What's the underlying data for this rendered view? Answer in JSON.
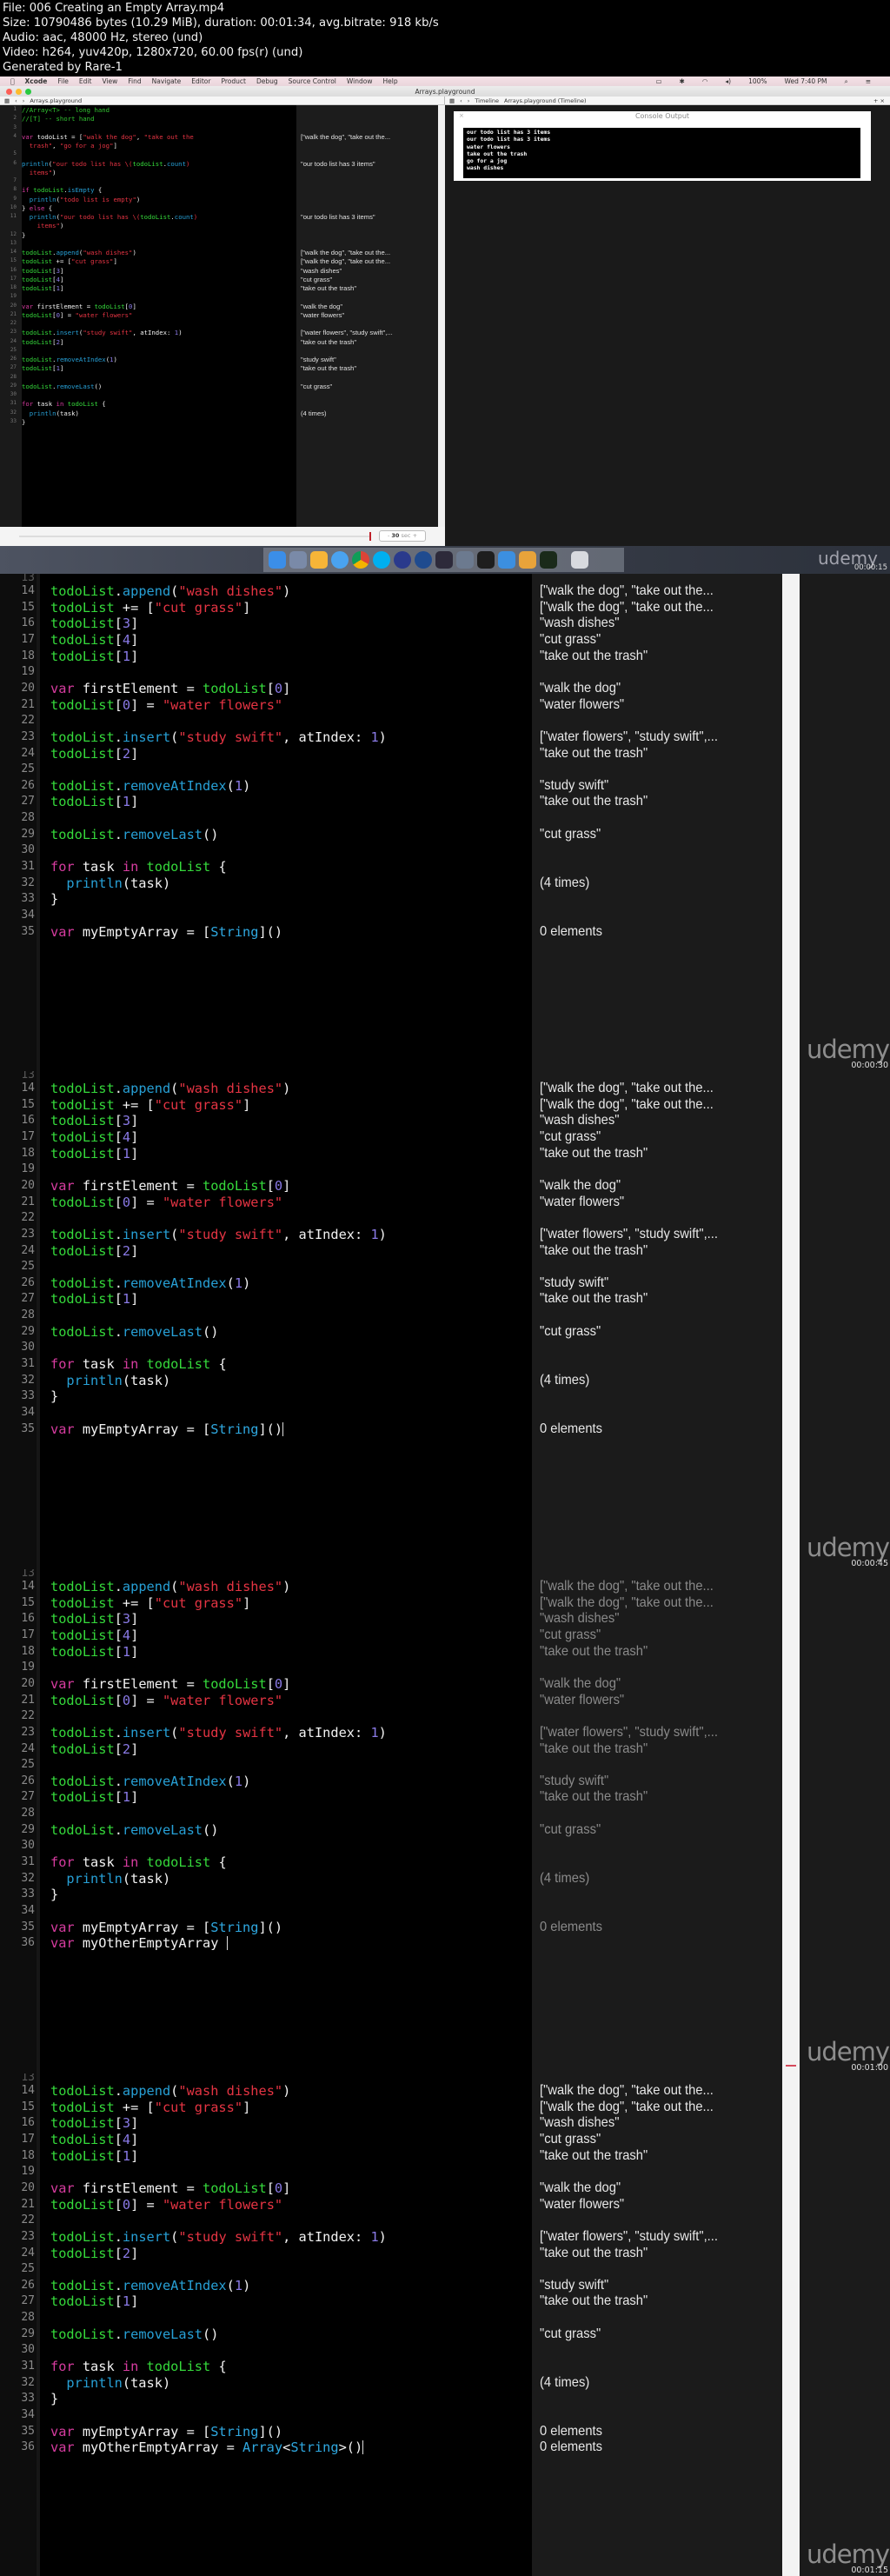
{
  "file_info": {
    "file": "File: 006 Creating an Empty Array.mp4",
    "size": "Size: 10790486 bytes (10.29 MiB), duration: 00:01:34, avg.bitrate: 918 kb/s",
    "audio": "Audio: aac, 48000 Hz, stereo (und)",
    "video": "Video: h264, yuv420p, 1280x720, 60.00 fps(r) (und)",
    "generator": "Generated by Rare-1"
  },
  "menubar": {
    "apple": "",
    "app": "Xcode",
    "items": [
      "File",
      "Edit",
      "View",
      "Find",
      "Navigate",
      "Editor",
      "Product",
      "Debug",
      "Source Control",
      "Window",
      "Help"
    ],
    "battery": "100%",
    "clock": "Wed 7:40 PM"
  },
  "window": {
    "title": "Arrays.playground",
    "left_jump": "Arrays.playground",
    "right_jump_1": "Timeline",
    "right_jump_2": "Arrays.playground (Timeline)",
    "add": "+",
    "close": "×"
  },
  "code_full": [
    {
      "n": "1",
      "t": [
        [
          "cm",
          "//Array<T> -- long hand"
        ]
      ]
    },
    {
      "n": "2",
      "t": [
        [
          "cm",
          "//[T] -- short hand"
        ]
      ]
    },
    {
      "n": "3",
      "t": []
    },
    {
      "n": "4",
      "t": [
        [
          "kw",
          "var"
        ],
        [
          "pl",
          " todoList = ["
        ],
        [
          "st",
          "\"walk the dog\""
        ],
        [
          "pl",
          ", "
        ],
        [
          "st",
          "\"take out the"
        ]
      ]
    },
    {
      "n": "",
      "t": [
        [
          "st",
          "  trash\""
        ],
        [
          "pl",
          ", "
        ],
        [
          "st",
          "\"go for a jog\""
        ],
        [
          "pl",
          "]"
        ]
      ]
    },
    {
      "n": "5",
      "t": []
    },
    {
      "n": "6",
      "t": [
        [
          "fn",
          "println"
        ],
        [
          "pl",
          "("
        ],
        [
          "st",
          "\"our todo list has \\("
        ],
        [
          "id",
          "todoList"
        ],
        [
          "pl",
          "."
        ],
        [
          "fn",
          "count"
        ],
        [
          "st",
          ")"
        ]
      ]
    },
    {
      "n": "",
      "t": [
        [
          "st",
          "  items\""
        ],
        [
          "pl",
          ")"
        ]
      ]
    },
    {
      "n": "7",
      "t": []
    },
    {
      "n": "8",
      "t": [
        [
          "kw",
          "if"
        ],
        [
          "pl",
          " "
        ],
        [
          "id",
          "todoList"
        ],
        [
          "pl",
          "."
        ],
        [
          "fn",
          "isEmpty"
        ],
        [
          "pl",
          " {"
        ]
      ]
    },
    {
      "n": "9",
      "t": [
        [
          "pl",
          "  "
        ],
        [
          "fn",
          "println"
        ],
        [
          "pl",
          "("
        ],
        [
          "st",
          "\"todo list is empty\""
        ],
        [
          "pl",
          ")"
        ]
      ]
    },
    {
      "n": "10",
      "t": [
        [
          "pl",
          "} "
        ],
        [
          "kw",
          "else"
        ],
        [
          "pl",
          " {"
        ]
      ]
    },
    {
      "n": "11",
      "t": [
        [
          "pl",
          "  "
        ],
        [
          "fn",
          "println"
        ],
        [
          "pl",
          "("
        ],
        [
          "st",
          "\"our todo list has \\("
        ],
        [
          "id",
          "todoList"
        ],
        [
          "pl",
          "."
        ],
        [
          "fn",
          "count"
        ],
        [
          "st",
          ")"
        ]
      ]
    },
    {
      "n": "",
      "t": [
        [
          "st",
          "    items\""
        ],
        [
          "pl",
          ")"
        ]
      ]
    },
    {
      "n": "12",
      "t": [
        [
          "pl",
          "}"
        ]
      ]
    },
    {
      "n": "13",
      "t": []
    },
    {
      "n": "14",
      "t": [
        [
          "id",
          "todoList"
        ],
        [
          "pl",
          "."
        ],
        [
          "fn",
          "append"
        ],
        [
          "pl",
          "("
        ],
        [
          "st",
          "\"wash dishes\""
        ],
        [
          "pl",
          ")"
        ]
      ]
    },
    {
      "n": "15",
      "t": [
        [
          "id",
          "todoList"
        ],
        [
          "pl",
          " += ["
        ],
        [
          "st",
          "\"cut grass\""
        ],
        [
          "pl",
          "]"
        ]
      ]
    },
    {
      "n": "16",
      "t": [
        [
          "id",
          "todoList"
        ],
        [
          "pl",
          "["
        ],
        [
          "nm",
          "3"
        ],
        [
          "pl",
          "]"
        ]
      ]
    },
    {
      "n": "17",
      "t": [
        [
          "id",
          "todoList"
        ],
        [
          "pl",
          "["
        ],
        [
          "nm",
          "4"
        ],
        [
          "pl",
          "]"
        ]
      ]
    },
    {
      "n": "18",
      "t": [
        [
          "id",
          "todoList"
        ],
        [
          "pl",
          "["
        ],
        [
          "nm",
          "1"
        ],
        [
          "pl",
          "]"
        ]
      ]
    },
    {
      "n": "19",
      "t": []
    },
    {
      "n": "20",
      "t": [
        [
          "kw",
          "var"
        ],
        [
          "pl",
          " firstElement = "
        ],
        [
          "id",
          "todoList"
        ],
        [
          "pl",
          "["
        ],
        [
          "nm",
          "0"
        ],
        [
          "pl",
          "]"
        ]
      ]
    },
    {
      "n": "21",
      "t": [
        [
          "id",
          "todoList"
        ],
        [
          "pl",
          "["
        ],
        [
          "nm",
          "0"
        ],
        [
          "pl",
          "] = "
        ],
        [
          "st",
          "\"water flowers\""
        ]
      ]
    },
    {
      "n": "22",
      "t": []
    },
    {
      "n": "23",
      "t": [
        [
          "id",
          "todoList"
        ],
        [
          "pl",
          "."
        ],
        [
          "fn",
          "insert"
        ],
        [
          "pl",
          "("
        ],
        [
          "st",
          "\"study swift\""
        ],
        [
          "pl",
          ", atIndex: "
        ],
        [
          "nm",
          "1"
        ],
        [
          "pl",
          ")"
        ]
      ]
    },
    {
      "n": "24",
      "t": [
        [
          "id",
          "todoList"
        ],
        [
          "pl",
          "["
        ],
        [
          "nm",
          "2"
        ],
        [
          "pl",
          "]"
        ]
      ]
    },
    {
      "n": "25",
      "t": []
    },
    {
      "n": "26",
      "t": [
        [
          "id",
          "todoList"
        ],
        [
          "pl",
          "."
        ],
        [
          "fn",
          "removeAtIndex"
        ],
        [
          "pl",
          "("
        ],
        [
          "nm",
          "1"
        ],
        [
          "pl",
          ")"
        ]
      ]
    },
    {
      "n": "27",
      "t": [
        [
          "id",
          "todoList"
        ],
        [
          "pl",
          "["
        ],
        [
          "nm",
          "1"
        ],
        [
          "pl",
          "]"
        ]
      ]
    },
    {
      "n": "28",
      "t": []
    },
    {
      "n": "29",
      "t": [
        [
          "id",
          "todoList"
        ],
        [
          "pl",
          "."
        ],
        [
          "fn",
          "removeLast"
        ],
        [
          "pl",
          "()"
        ]
      ]
    },
    {
      "n": "30",
      "t": []
    },
    {
      "n": "31",
      "t": [
        [
          "kw",
          "for"
        ],
        [
          "pl",
          " task "
        ],
        [
          "kw",
          "in"
        ],
        [
          "pl",
          " "
        ],
        [
          "id",
          "todoList"
        ],
        [
          "pl",
          " {"
        ]
      ]
    },
    {
      "n": "32",
      "t": [
        [
          "pl",
          "  "
        ],
        [
          "fn",
          "println"
        ],
        [
          "pl",
          "(task)"
        ]
      ]
    },
    {
      "n": "33",
      "t": [
        [
          "pl",
          "}"
        ]
      ]
    }
  ],
  "results_full": [
    "",
    "",
    "",
    "[\"walk the dog\", \"take out the...",
    "",
    "",
    "\"our todo list has 3 items\"",
    "",
    "",
    "",
    "",
    "",
    "\"our todo list has 3 items\"",
    "",
    "",
    "",
    "[\"walk the dog\", \"take out the...",
    "[\"walk the dog\", \"take out the...",
    "\"wash dishes\"",
    "\"cut grass\"",
    "\"take out the trash\"",
    "",
    "\"walk the dog\"",
    "\"water flowers\"",
    "",
    "[\"water flowers\", \"study swift\",...",
    "\"take out the trash\"",
    "",
    "\"study swift\"",
    "\"take out the trash\"",
    "",
    "\"cut grass\"",
    "",
    "",
    "(4 times)",
    ""
  ],
  "console": {
    "title": "Console Output",
    "close": "×",
    "lines": [
      "our todo list has 3 items",
      "our todo list has 3 items",
      "water flowers",
      "take out the trash",
      "go for a jog",
      "wash dishes"
    ]
  },
  "timeline": {
    "duration_value": "30",
    "duration_unit": "sec",
    "minus": "-",
    "plus": "+"
  },
  "watermark": "udemy",
  "timestamps": [
    "00:00:15",
    "00:00:30",
    "00:00:45",
    "00:01:00",
    "00:01:15"
  ],
  "zoom_code": [
    {
      "n": "14",
      "t": [
        [
          "id",
          "todoList"
        ],
        [
          "pl",
          "."
        ],
        [
          "fn",
          "append"
        ],
        [
          "pl",
          "("
        ],
        [
          "st",
          "\"wash dishes\""
        ],
        [
          "pl",
          ")"
        ]
      ],
      "r": "[\"walk the dog\", \"take out the..."
    },
    {
      "n": "15",
      "t": [
        [
          "id",
          "todoList"
        ],
        [
          "pl",
          " += ["
        ],
        [
          "st",
          "\"cut grass\""
        ],
        [
          "pl",
          "]"
        ]
      ],
      "r": "[\"walk the dog\", \"take out the..."
    },
    {
      "n": "16",
      "t": [
        [
          "id",
          "todoList"
        ],
        [
          "pl",
          "["
        ],
        [
          "nm",
          "3"
        ],
        [
          "pl",
          "]"
        ]
      ],
      "r": "\"wash dishes\""
    },
    {
      "n": "17",
      "t": [
        [
          "id",
          "todoList"
        ],
        [
          "pl",
          "["
        ],
        [
          "nm",
          "4"
        ],
        [
          "pl",
          "]"
        ]
      ],
      "r": "\"cut grass\""
    },
    {
      "n": "18",
      "t": [
        [
          "id",
          "todoList"
        ],
        [
          "pl",
          "["
        ],
        [
          "nm",
          "1"
        ],
        [
          "pl",
          "]"
        ]
      ],
      "r": "\"take out the trash\""
    },
    {
      "n": "19",
      "t": [],
      "r": ""
    },
    {
      "n": "20",
      "t": [
        [
          "kw",
          "var"
        ],
        [
          "pl",
          " firstElement = "
        ],
        [
          "id",
          "todoList"
        ],
        [
          "pl",
          "["
        ],
        [
          "nm",
          "0"
        ],
        [
          "pl",
          "]"
        ]
      ],
      "r": "\"walk the dog\""
    },
    {
      "n": "21",
      "t": [
        [
          "id",
          "todoList"
        ],
        [
          "pl",
          "["
        ],
        [
          "nm",
          "0"
        ],
        [
          "pl",
          "] = "
        ],
        [
          "st",
          "\"water flowers\""
        ]
      ],
      "r": "\"water flowers\""
    },
    {
      "n": "22",
      "t": [],
      "r": ""
    },
    {
      "n": "23",
      "t": [
        [
          "id",
          "todoList"
        ],
        [
          "pl",
          "."
        ],
        [
          "fn",
          "insert"
        ],
        [
          "pl",
          "("
        ],
        [
          "st",
          "\"study swift\""
        ],
        [
          "pl",
          ", atIndex: "
        ],
        [
          "nm",
          "1"
        ],
        [
          "pl",
          ")"
        ]
      ],
      "r": "[\"water flowers\", \"study swift\",..."
    },
    {
      "n": "24",
      "t": [
        [
          "id",
          "todoList"
        ],
        [
          "pl",
          "["
        ],
        [
          "nm",
          "2"
        ],
        [
          "pl",
          "]"
        ]
      ],
      "r": "\"take out the trash\""
    },
    {
      "n": "25",
      "t": [],
      "r": ""
    },
    {
      "n": "26",
      "t": [
        [
          "id",
          "todoList"
        ],
        [
          "pl",
          "."
        ],
        [
          "fn",
          "removeAtIndex"
        ],
        [
          "pl",
          "("
        ],
        [
          "nm",
          "1"
        ],
        [
          "pl",
          ")"
        ]
      ],
      "r": "\"study swift\""
    },
    {
      "n": "27",
      "t": [
        [
          "id",
          "todoList"
        ],
        [
          "pl",
          "["
        ],
        [
          "nm",
          "1"
        ],
        [
          "pl",
          "]"
        ]
      ],
      "r": "\"take out the trash\""
    },
    {
      "n": "28",
      "t": [],
      "r": ""
    },
    {
      "n": "29",
      "t": [
        [
          "id",
          "todoList"
        ],
        [
          "pl",
          "."
        ],
        [
          "fn",
          "removeLast"
        ],
        [
          "pl",
          "()"
        ]
      ],
      "r": "\"cut grass\""
    },
    {
      "n": "30",
      "t": [],
      "r": ""
    },
    {
      "n": "31",
      "t": [
        [
          "kw",
          "for"
        ],
        [
          "pl",
          " task "
        ],
        [
          "kw",
          "in"
        ],
        [
          "pl",
          " "
        ],
        [
          "id",
          "todoList"
        ],
        [
          "pl",
          " {"
        ]
      ],
      "r": ""
    },
    {
      "n": "32",
      "t": [
        [
          "pl",
          "  "
        ],
        [
          "fn",
          "println"
        ],
        [
          "pl",
          "(task)"
        ]
      ],
      "r": "(4 times)"
    },
    {
      "n": "33",
      "t": [
        [
          "pl",
          "}"
        ]
      ],
      "r": ""
    },
    {
      "n": "34",
      "t": [],
      "r": ""
    },
    {
      "n": "35",
      "t": [
        [
          "kw",
          "var"
        ],
        [
          "pl",
          " myEmptyArray = ["
        ],
        [
          "ty",
          "String"
        ],
        [
          "pl",
          "]()"
        ]
      ],
      "r": "0 elements"
    }
  ],
  "frames": [
    {
      "timestamp": "00:00:30",
      "extra": [],
      "caret_line": -1,
      "dim": false
    },
    {
      "timestamp": "00:00:45",
      "extra": [],
      "caret_line": 21,
      "dim": false
    },
    {
      "timestamp": "00:01:00",
      "extra": [
        {
          "n": "36",
          "t": [
            [
              "kw",
              "var"
            ],
            [
              "pl",
              " myOtherEmptyArray "
            ]
          ],
          "r": ""
        }
      ],
      "caret_line": 22,
      "dim": true
    },
    {
      "timestamp": "00:01:15",
      "extra": [
        {
          "n": "36",
          "t": [
            [
              "kw",
              "var"
            ],
            [
              "pl",
              " myOtherEmptyArray = "
            ],
            [
              "ty",
              "Array"
            ],
            [
              "pl",
              "<"
            ],
            [
              "ty",
              "String"
            ],
            [
              "pl",
              ">()"
            ]
          ],
          "r": "0 elements"
        }
      ],
      "caret_line": 22,
      "dim": false
    }
  ]
}
